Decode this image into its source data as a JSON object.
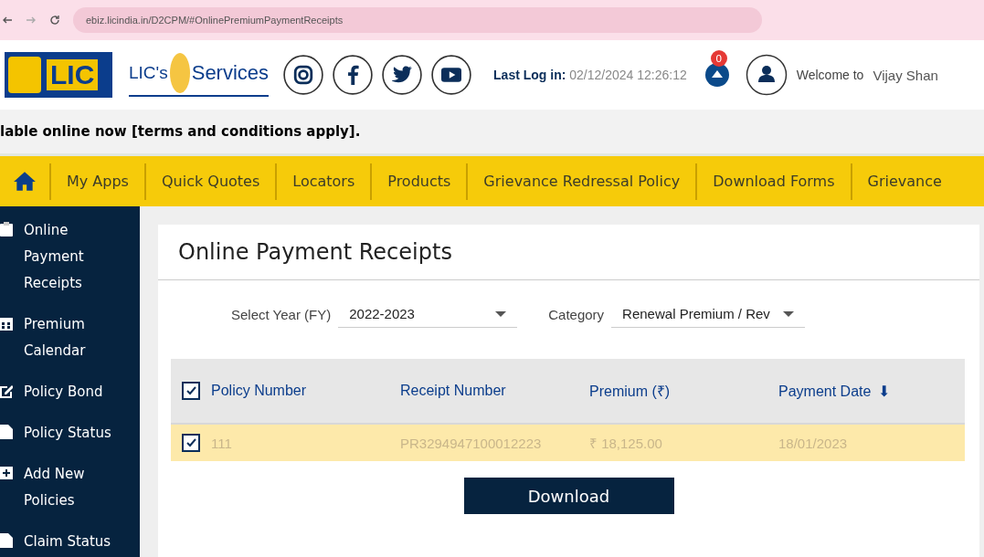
{
  "browser": {
    "url": "ebiz.licindia.in/D2CPM/#OnlinePremiumPaymentReceipts"
  },
  "header": {
    "logo_text": "LIC",
    "brand": "LIC's",
    "brand_suffix": "Services",
    "last_login_label": "Last Log in:",
    "last_login": "02/12/2024 12:26:12",
    "notifications": "0",
    "welcome": "Welcome to",
    "user": "Vijay Shan"
  },
  "marquee": "lable online now [terms and conditions apply].",
  "nav": [
    "My Apps",
    "Quick Quotes",
    "Locators",
    "Products",
    "Grievance Redressal Policy",
    "Download Forms",
    "Grievance"
  ],
  "sidebar": [
    {
      "label": "Online Payment Receipts",
      "kind": "clipboard"
    },
    {
      "label": "Premium Calendar",
      "kind": "calendar"
    },
    {
      "label": "Policy Bond",
      "kind": "edit"
    },
    {
      "label": "Policy Status",
      "kind": "doc"
    },
    {
      "label": "Add New Policies",
      "kind": "plus"
    },
    {
      "label": "Claim Status",
      "kind": "doc"
    }
  ],
  "page_title": "Online Payment Receipts",
  "filters": [
    {
      "label": "Select Year (FY)",
      "value": "2022-2023"
    },
    {
      "label": "Category",
      "value": "Renewal Premium / Rev"
    }
  ],
  "table": {
    "all_checked": true,
    "columns": [
      "Policy Number",
      "Receipt Number",
      "Premium (₹)",
      "Payment Date"
    ],
    "sort_icon": "⬇",
    "rows": [
      {
        "checked": true,
        "cells": [
          "111",
          "PR3294947100012223",
          "₹ 18,125.00",
          "18/01/2023"
        ]
      }
    ]
  },
  "download": "Download"
}
